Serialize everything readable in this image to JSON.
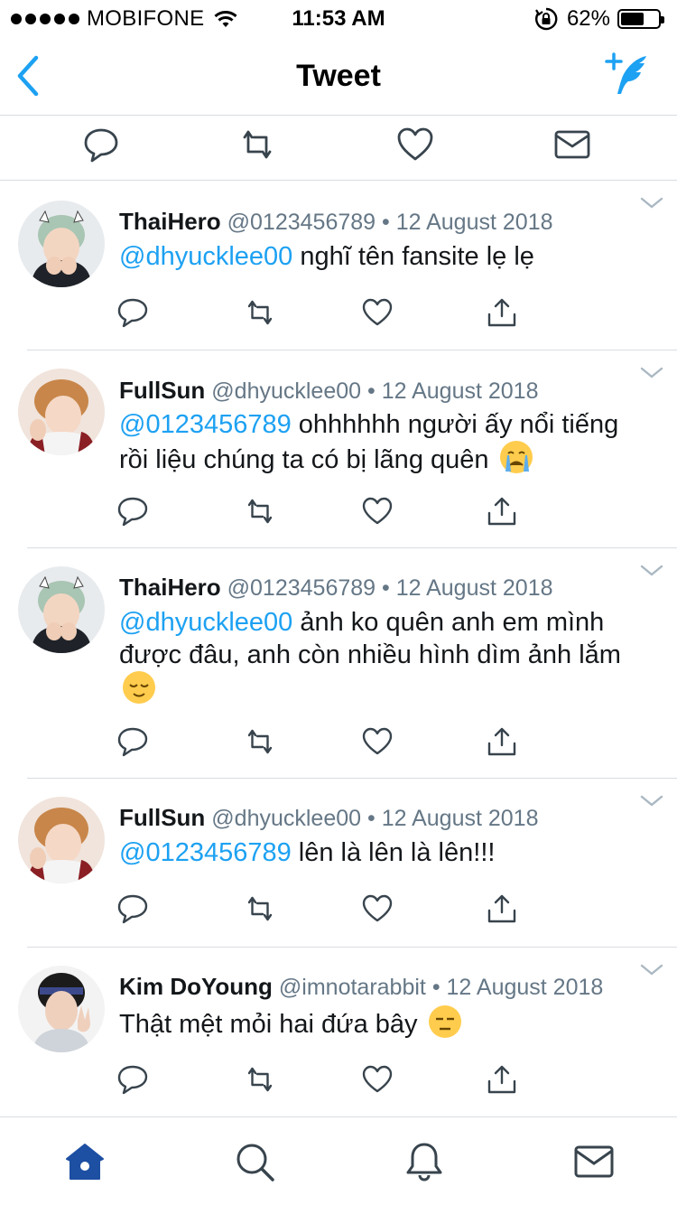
{
  "status_bar": {
    "carrier": "MOBIFONE",
    "time": "11:53 AM",
    "battery_percent": "62%",
    "battery_level": 0.62
  },
  "nav": {
    "title": "Tweet",
    "back_icon": "chevron-left-icon",
    "compose_icon": "compose-tweet-icon"
  },
  "colors": {
    "accent": "#1da1f2",
    "text": "#14171a",
    "secondary": "#657786",
    "divider": "#d9dde1",
    "tab_active": "#1d4fa3",
    "tab_inactive": "#38444d"
  },
  "main_actions": [
    "reply-icon",
    "retweet-icon",
    "like-icon",
    "message-icon"
  ],
  "tweets": [
    {
      "name": "ThaiHero",
      "handle": "@0123456789",
      "date": "12 August 2018",
      "mention": "@dhyucklee00",
      "text": " nghĩ tên fansite lẹ lẹ",
      "emoji": ""
    },
    {
      "name": "FullSun",
      "handle": "@dhyucklee00",
      "date": "12 August 2018",
      "mention": "@0123456789",
      "text": " ohhhhhh người ấy nổi tiếng rồi liệu chúng ta có bị lãng quên",
      "emoji": "crying-face"
    },
    {
      "name": "ThaiHero",
      "handle": "@0123456789",
      "date": "12 August 2018",
      "mention": "@dhyucklee00",
      "text": " ảnh ko quên anh em mình được đâu, anh còn nhiều hình dìm ảnh lắm",
      "emoji": "relieved-face"
    },
    {
      "name": "FullSun",
      "handle": "@dhyucklee00",
      "date": "12 August 2018",
      "mention": "@0123456789",
      "text": " lên là lên là lên!!!",
      "emoji": ""
    },
    {
      "name": "Kim DoYoung",
      "handle": "@imnotarabbit",
      "date": "12 August 2018",
      "mention": "",
      "text": "Thật mệt mỏi hai đứa bây",
      "emoji": "expressionless-face"
    }
  ],
  "tab_bar": {
    "tabs": [
      "home-icon",
      "search-icon",
      "notifications-icon",
      "messages-icon"
    ],
    "active": "home-icon"
  }
}
